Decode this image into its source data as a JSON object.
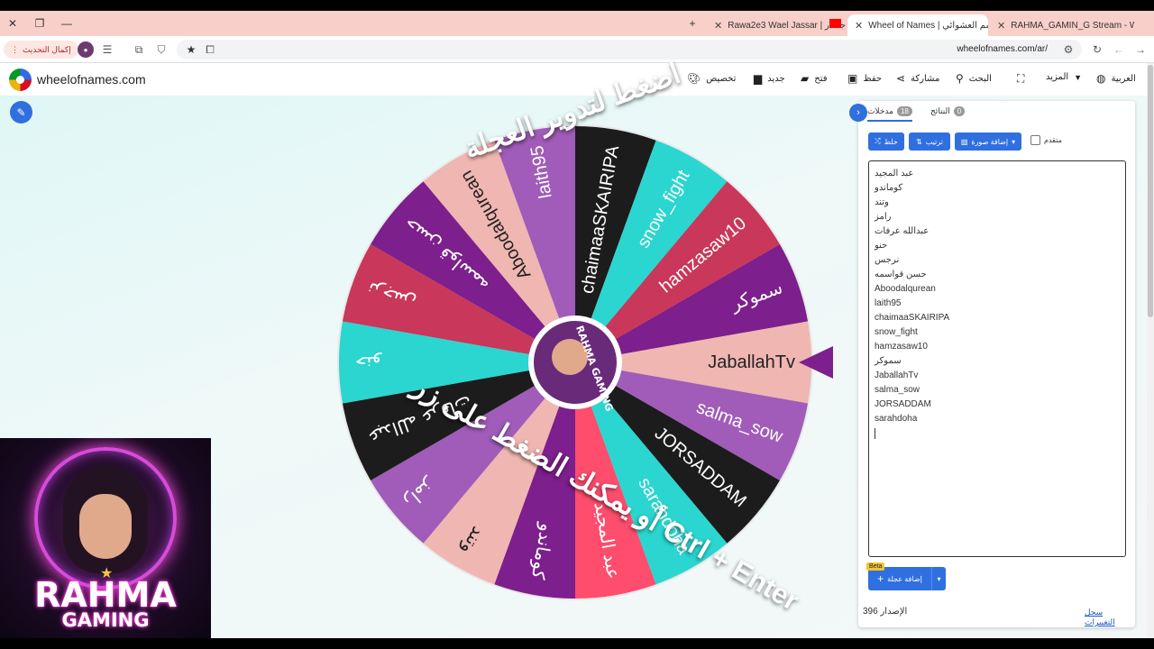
{
  "browser": {
    "tabs": [
      {
        "title": "RAHMA_GAMIN_G Stream - W",
        "favicon_color": "#1db954"
      },
      {
        "title": "Wheel of Names | سم العشوائي",
        "favicon_color": "#4285f4"
      },
      {
        "title": "Rawa2e3 Wael Jassar | ل جسار",
        "favicon_color": "#ff0000"
      }
    ],
    "update_label": "إكمال التحديث",
    "url": "wheelofnames.com/ar/"
  },
  "site": {
    "logo_text": "wheelofnames.com",
    "nav": {
      "customize": "تخصيص",
      "new": "جديد",
      "open": "فتح",
      "save": "حفظ",
      "share": "مشاركة",
      "search": "البحث",
      "more": "المزيد",
      "language": "العربية"
    }
  },
  "wheel": {
    "hint_line1": "اضغط لتدوير العجلة",
    "hint_line2": "أو يمكنك الضغط على زر Ctrl + Enter",
    "segments": [
      {
        "label": "عبد المجيد",
        "color": "#ff4d6d"
      },
      {
        "label": "كوماندو",
        "color": "#7d1f8c"
      },
      {
        "label": "وتند",
        "color": "#f0b6b2"
      },
      {
        "label": "رامز",
        "color": "#a05cb8"
      },
      {
        "label": "عبدالله عرفات",
        "color": "#1c1c1c"
      },
      {
        "label": "حنو",
        "color": "#2ad6cf"
      },
      {
        "label": "نرجس",
        "color": "#c9375a"
      },
      {
        "label": "حسن قواسمه",
        "color": "#7d1f8c"
      },
      {
        "label": "Aboodalqurean",
        "color": "#f0b6b2"
      },
      {
        "label": "laith95",
        "color": "#a05cb8"
      },
      {
        "label": "chaimaaSKAIRIPA",
        "color": "#1c1c1c"
      },
      {
        "label": "snow_fight",
        "color": "#2ad6cf"
      },
      {
        "label": "hamzasaw10",
        "color": "#c9375a"
      },
      {
        "label": "سموكر",
        "color": "#7d1f8c"
      },
      {
        "label": "JaballahTv",
        "color": "#f0b6b2"
      },
      {
        "label": "salma_sow",
        "color": "#a05cb8"
      },
      {
        "label": "JORSADDAM",
        "color": "#1c1c1c"
      },
      {
        "label": "sarahdoha",
        "color": "#2ad6cf"
      }
    ],
    "center_text": "RAHMA GAMING"
  },
  "webcam": {
    "line1": "RAHMA",
    "line2": "GAMING"
  },
  "panel": {
    "tab_entries": "مدخلات",
    "entries_count": "18",
    "tab_results": "النتائج",
    "results_count": "0",
    "shuffle_label": "خلط",
    "sort_label": "ترتيب",
    "add_image_label": "إضافة صورة",
    "advanced_label": "متقدم",
    "entries": [
      "عبد المجيد",
      "كوماندو",
      "وتند",
      "رامز",
      "عبدالله عرفات",
      "حنو",
      "نرجس",
      "حسن قواسمه",
      "Aboodalqurean",
      "laith95",
      "chaimaaSKAIRIPA",
      "snow_fight",
      "hamzasaw10",
      "سموكر",
      "JaballahTv",
      "salma_sow",
      "JORSADDAM",
      "sarahdoha"
    ],
    "add_wheel_label": "إضافة عجلة",
    "beta_label": "Beta",
    "version_label": "الإصدار",
    "version_number": "396",
    "changelog_label": "سجل التغييرات"
  }
}
